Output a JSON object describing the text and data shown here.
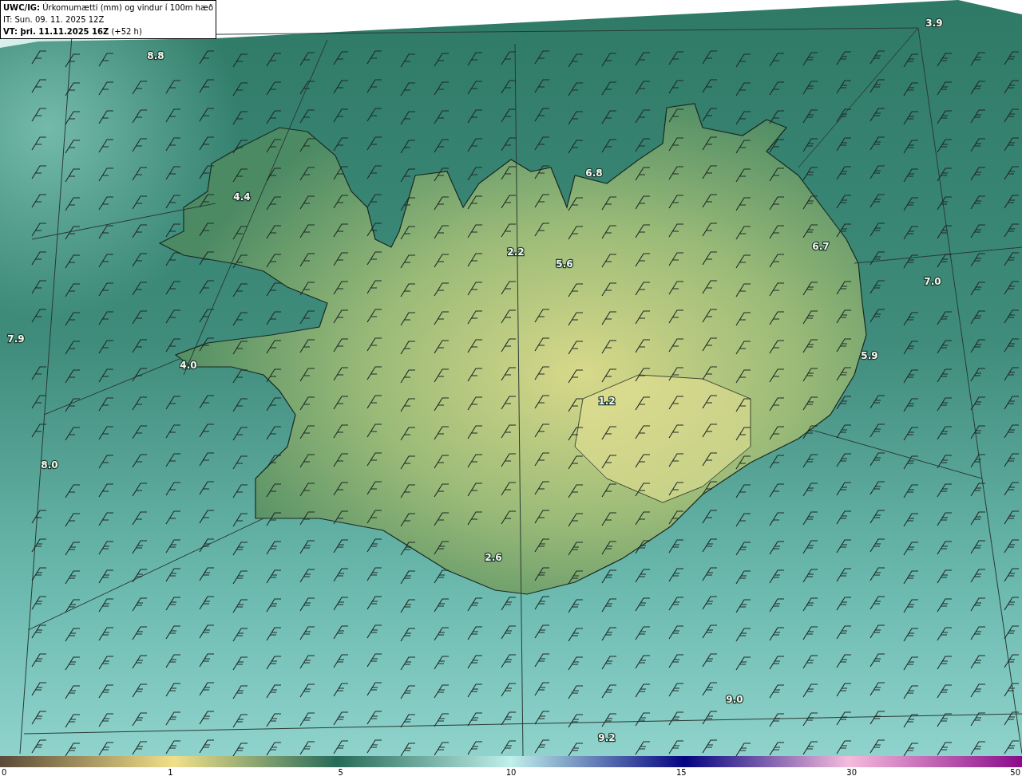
{
  "header": {
    "title": "**UWC/IG:** Úrkomumætti (mm) og vindur í 100m hæð",
    "issue_time": "IT: Sun. 09. 11. 2025 12Z",
    "valid_time": "**VT: þri. 11.11.2025 16Z** (+52 h)"
  },
  "map": {
    "value_labels": [
      "3.9",
      "8.8",
      "4.4",
      "6.8",
      "2.2",
      "5.6",
      "6.7",
      "7.0",
      "7.9",
      "4.0",
      "5.9",
      "1.2",
      "8.0",
      "2.6",
      "9.0",
      "9.2"
    ]
  },
  "colorbar": {
    "ticks": [
      "0",
      "1",
      "5",
      "10",
      "15",
      "30",
      "50"
    ]
  }
}
